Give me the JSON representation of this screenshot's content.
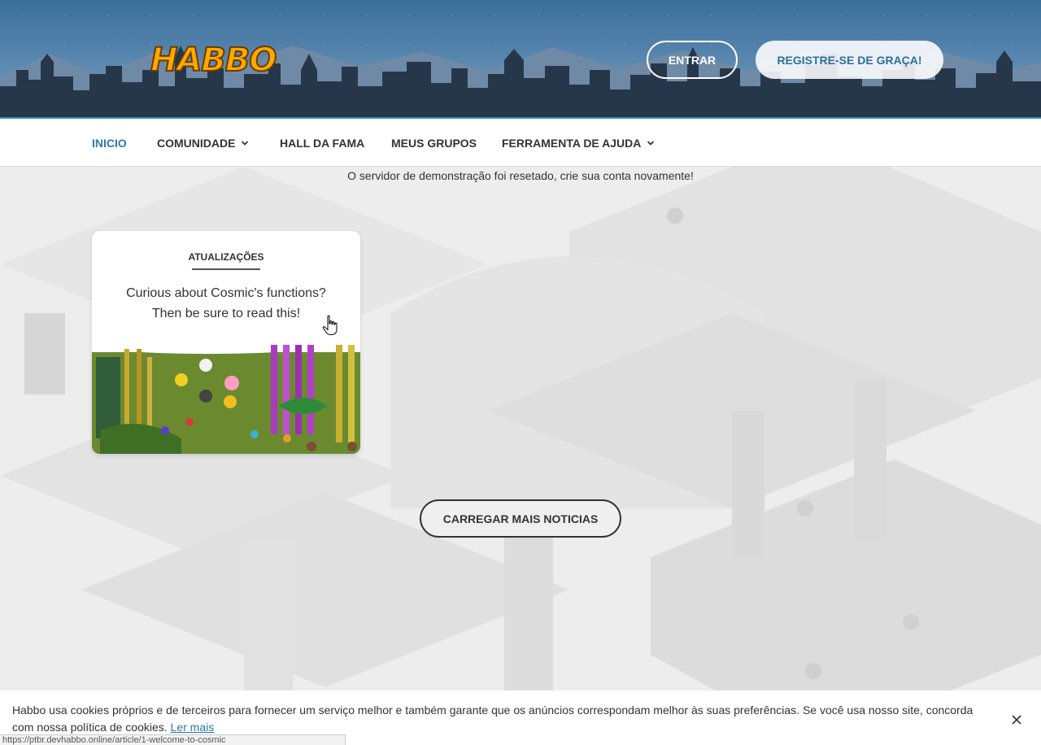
{
  "header": {
    "logo_text": "HABBO",
    "login_label": "ENTRAR",
    "register_label": "REGISTRE-SE DE GRAÇA!"
  },
  "nav": {
    "items": [
      {
        "label": "INICIO",
        "active": true,
        "dropdown": false
      },
      {
        "label": "COMUNIDADE",
        "active": false,
        "dropdown": true
      },
      {
        "label": "HALL DA FAMA",
        "active": false,
        "dropdown": false
      },
      {
        "label": "MEUS GRUPOS",
        "active": false,
        "dropdown": false
      },
      {
        "label": "FERRAMENTA DE AJUDA",
        "active": false,
        "dropdown": true
      }
    ]
  },
  "main": {
    "notice": "O servidor de demonstração foi resetado, crie sua conta novamente!",
    "news_card": {
      "tag": "ATUALIZAÇÕES",
      "title_line1": "Curious about Cosmic's functions?",
      "title_line2": "Then be sure to read this!"
    },
    "load_more_label": "CARREGAR MAIS NOTICIAS"
  },
  "cookie_bar": {
    "text": "Habbo usa cookies próprios e de terceiros para fornecer um serviço melhor e também garante que os anúncios correspondam melhor às suas preferências. Se você usa nosso site, concorda com nossa política de cookies.",
    "link_label": "Ler mais"
  },
  "status_url": "https://ptbr.devhabbo.online/article/1-welcome-to-cosmic",
  "colors": {
    "accent": "#2b7aa8",
    "logo": "#ffa900",
    "sky": "#5584ad"
  },
  "icons": [
    "chevron-down-icon",
    "close-icon",
    "hand-cursor-icon"
  ]
}
